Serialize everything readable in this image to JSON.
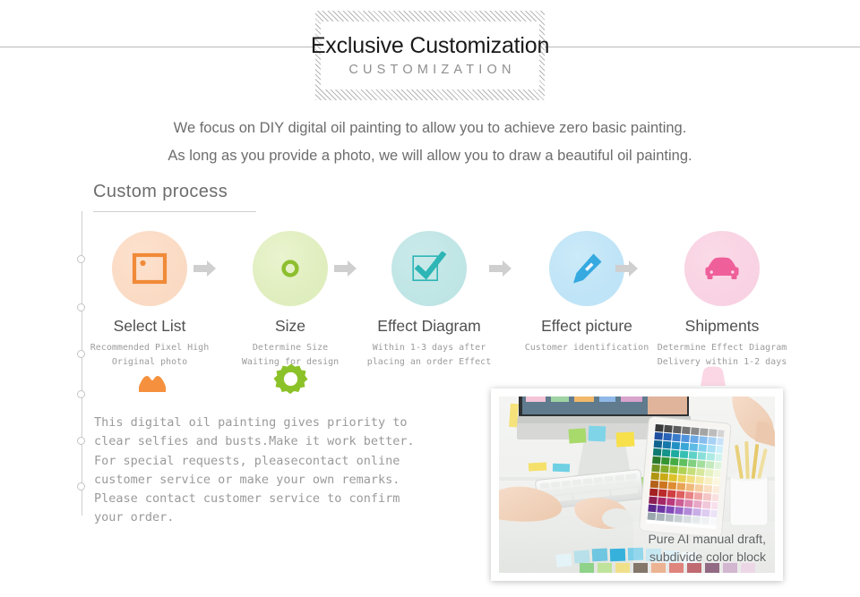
{
  "header": {
    "title": "Exclusive Customization",
    "subtitle": "CUSTOMIZATION"
  },
  "intro": {
    "line1": "We focus on DIY digital oil painting to allow you to achieve zero basic painting.",
    "line2": "As long as you provide a photo, we will allow you to draw a beautiful oil painting."
  },
  "section": {
    "title": "Custom process"
  },
  "process": {
    "steps": [
      {
        "icon": "picture-icon",
        "title": "Select List",
        "desc_line1": "Recommended Pixel High",
        "desc_line2": "Original photo",
        "color": "#f9d8c0",
        "icon_color": "#f08a38"
      },
      {
        "icon": "ring-icon",
        "title": "Size",
        "desc_line1": "Determine Size",
        "desc_line2": "Waiting for design",
        "color": "#dcecb9",
        "icon_color": "#8dbf2e"
      },
      {
        "icon": "checkbox-icon",
        "title": "Effect Diagram",
        "desc_line1": "Within 1-3 days after",
        "desc_line2": "placing an order Effect",
        "color": "#bbe3e4",
        "icon_color": "#2eb5b5"
      },
      {
        "icon": "pen-icon",
        "title": "Effect picture",
        "desc_line1": "Customer identification",
        "desc_line2": "",
        "color": "#bce3f7",
        "icon_color": "#35a9e0"
      },
      {
        "icon": "car-icon",
        "title": "Shipments",
        "desc_line1": "Determine Effect Diagram",
        "desc_line2": "Delivery within 1-2 days",
        "color": "#f8d1e2",
        "icon_color": "#ef5f9a"
      }
    ],
    "arrow_icon": "arrow-right-icon"
  },
  "decorations": {
    "mountain_icon": "orange-mountain-shape",
    "mountain_color": "#f5913e",
    "gear_icon": "green-gear-icon",
    "gear_color": "#8cc229",
    "pink_icon": "pink-shape",
    "pink_color": "#fbd7e6"
  },
  "body": {
    "line1": "This digital oil painting gives priority to",
    "line2": "clear selfies and busts.Make it work better.",
    "line3": "For special requests, pleasecontact online",
    "line4": "customer service or make your own remarks.",
    "line5": "Please contact customer service to confirm",
    "line6": "your order."
  },
  "photo": {
    "caption_line1": "Pure AI manual draft,",
    "caption_line2": "subdivide color block",
    "alt": "designer working at desk with keyboard and tablet showing color palette"
  }
}
